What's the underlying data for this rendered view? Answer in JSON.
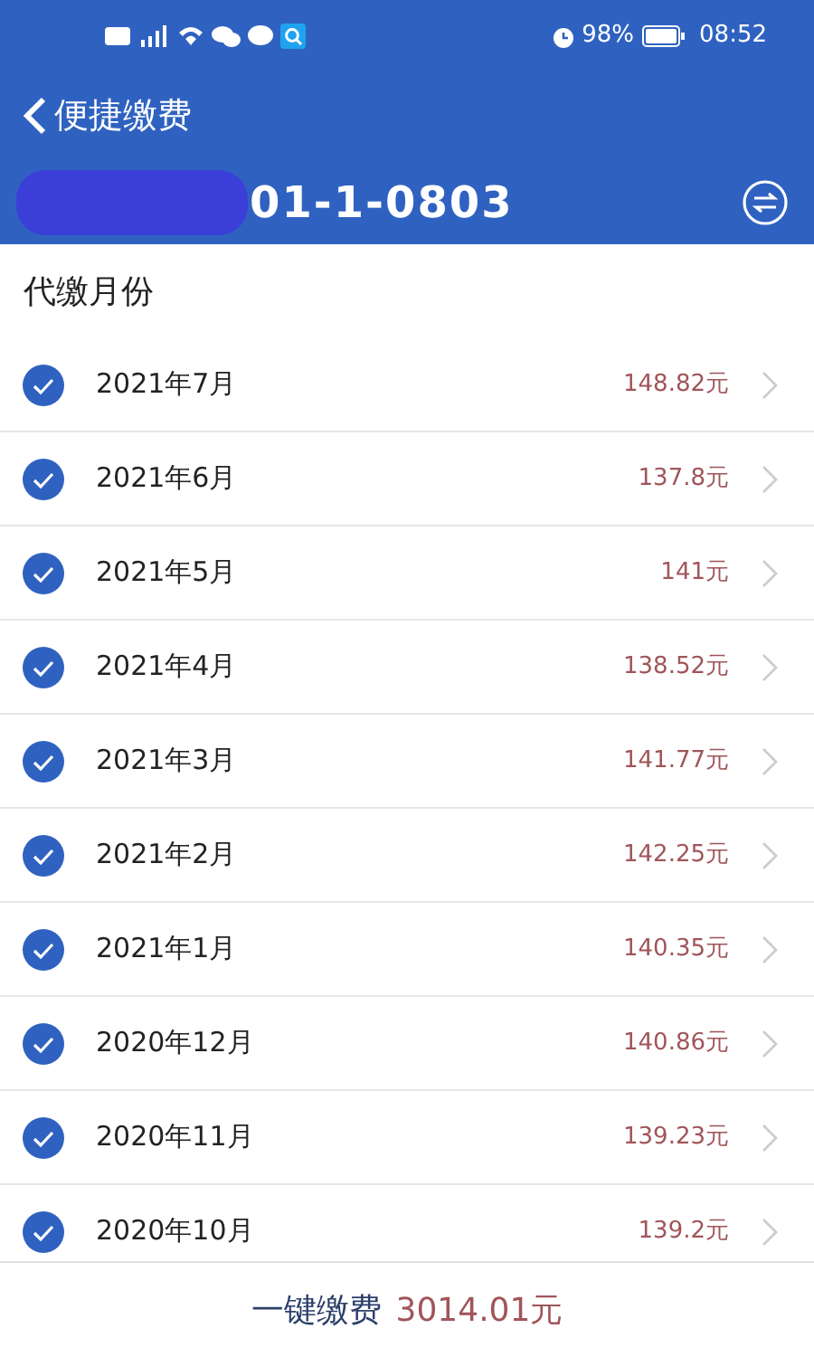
{
  "status_bar": {
    "time": "08:52",
    "battery": "98%"
  },
  "header": {
    "title": "便捷缴费"
  },
  "account": {
    "number": "01-1-0803"
  },
  "section_title": "代缴月份",
  "months": [
    {
      "label": "2021年7月",
      "amount": "148.82元",
      "checked": true
    },
    {
      "label": "2021年6月",
      "amount": "137.8元",
      "checked": true
    },
    {
      "label": "2021年5月",
      "amount": "141元",
      "checked": true
    },
    {
      "label": "2021年4月",
      "amount": "138.52元",
      "checked": true
    },
    {
      "label": "2021年3月",
      "amount": "141.77元",
      "checked": true
    },
    {
      "label": "2021年2月",
      "amount": "142.25元",
      "checked": true
    },
    {
      "label": "2021年1月",
      "amount": "140.35元",
      "checked": true
    },
    {
      "label": "2020年12月",
      "amount": "140.86元",
      "checked": true
    },
    {
      "label": "2020年11月",
      "amount": "139.23元",
      "checked": true
    },
    {
      "label": "2020年10月",
      "amount": "139.2元",
      "checked": true
    }
  ],
  "footer": {
    "label": "一键缴费",
    "total": "3014.01元"
  }
}
